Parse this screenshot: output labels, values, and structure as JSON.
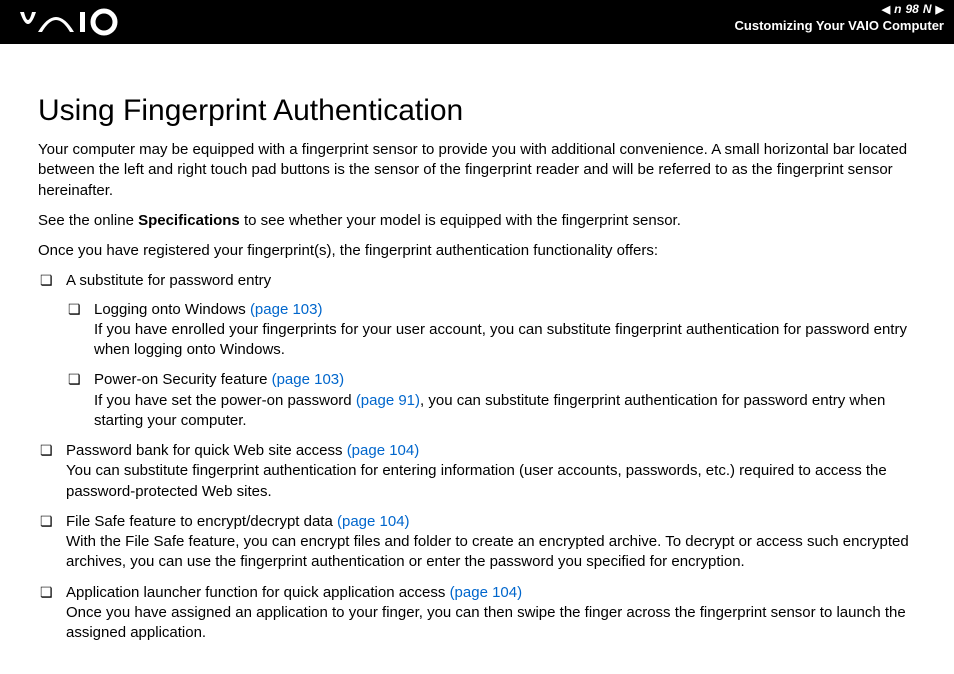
{
  "header": {
    "logo": "VAIO",
    "page_num": "98",
    "n_label": "n",
    "N_label": "N",
    "section": "Customizing Your VAIO Computer"
  },
  "title": "Using Fingerprint Authentication",
  "para1": "Your computer may be equipped with a fingerprint sensor to provide you with additional convenience. A small horizontal bar located between the left and right touch pad buttons is the sensor of the fingerprint reader and will be referred to as the fingerprint sensor hereinafter.",
  "para2_a": "See the online ",
  "para2_b": "Specifications",
  "para2_c": " to see whether your model is equipped with the fingerprint sensor.",
  "para3": "Once you have registered your fingerprint(s), the fingerprint authentication functionality offers:",
  "items": {
    "i1": "A substitute for password entry",
    "s1a": "Logging onto Windows ",
    "s1a_link": "(page 103)",
    "s1a_body": "If you have enrolled your fingerprints for your user account, you can substitute fingerprint authentication for password entry when logging onto Windows.",
    "s1b": "Power-on Security feature ",
    "s1b_link": "(page 103)",
    "s1b_body_a": "If you have set the power-on password ",
    "s1b_body_link": "(page 91)",
    "s1b_body_b": ", you can substitute fingerprint authentication for password entry when starting your computer.",
    "i2a": "Password bank for quick Web site access ",
    "i2_link": "(page 104)",
    "i2_body": "You can substitute fingerprint authentication for entering information (user accounts, passwords, etc.) required to access the password-protected Web sites.",
    "i3a": "File Safe feature to encrypt/decrypt data ",
    "i3_link": "(page 104)",
    "i3_body": "With the File Safe feature, you can encrypt files and folder to create an encrypted archive. To decrypt or access such encrypted archives, you can use the fingerprint authentication or enter the password you specified for encryption.",
    "i4a": "Application launcher function for quick application access ",
    "i4_link": "(page 104)",
    "i4_body": "Once you have assigned an application to your finger, you can then swipe the finger across the fingerprint sensor to launch the assigned application."
  }
}
